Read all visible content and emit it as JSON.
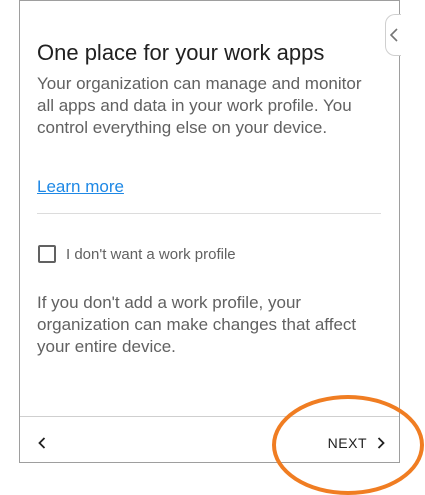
{
  "screen": {
    "title": "One place for your work apps",
    "description": "Your organization can manage and monitor all apps and data in your work profile. You control everything else on your device.",
    "learn_more_label": "Learn more",
    "checkbox": {
      "label": "I don't want a work profile",
      "checked": false
    },
    "note": "If you don't add a work profile, your organization can make changes that affect your entire device."
  },
  "navigation": {
    "back_icon": "chevron-left-icon",
    "next_label": "NEXT",
    "next_icon": "chevron-right-icon"
  },
  "side_tab": {
    "icon": "chevron-left-icon"
  },
  "annotation": {
    "highlight_color": "#f07d22",
    "highlight_target": "next-button"
  },
  "colors": {
    "link": "#1e88e5",
    "title_text": "#212121",
    "body_text": "#616161"
  }
}
